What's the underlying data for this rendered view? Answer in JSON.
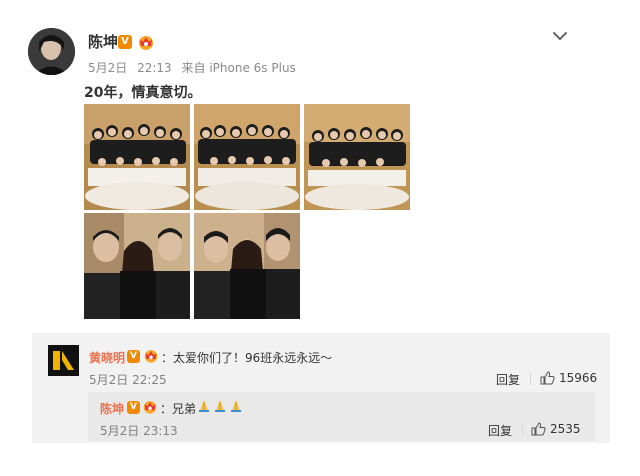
{
  "post": {
    "author": "陈坤",
    "date": "5月2日",
    "time": "22:13",
    "source": "来自 iPhone 6s Plus",
    "content": "20年，情真意切。",
    "photos": [
      {
        "name": "group-photo-1"
      },
      {
        "name": "group-photo-2"
      },
      {
        "name": "group-photo-3"
      },
      {
        "name": "trio-photo-1"
      },
      {
        "name": "trio-photo-2"
      }
    ]
  },
  "comments": [
    {
      "author": "黄晓明",
      "text": "太爱你们了！96班永远永远～",
      "date": "5月2日",
      "time": "22:25",
      "reply_label": "回复",
      "likes": "15966",
      "replies": [
        {
          "author": "陈坤",
          "text": "兄弟",
          "date": "5月2日",
          "time": "23:13",
          "reply_label": "回复",
          "likes": "2535"
        }
      ]
    }
  ],
  "colors": {
    "badge": "#f08a00",
    "comment_name": "#eb7350",
    "meta": "#8b8b8b",
    "comment_bg": "#f2f2f2",
    "nested_bg": "#e9e9e9"
  },
  "icons": [
    "verified-v-icon",
    "crown-member-icon",
    "chevron-down-icon",
    "thumbs-up-icon",
    "praying-hands-emoji"
  ]
}
